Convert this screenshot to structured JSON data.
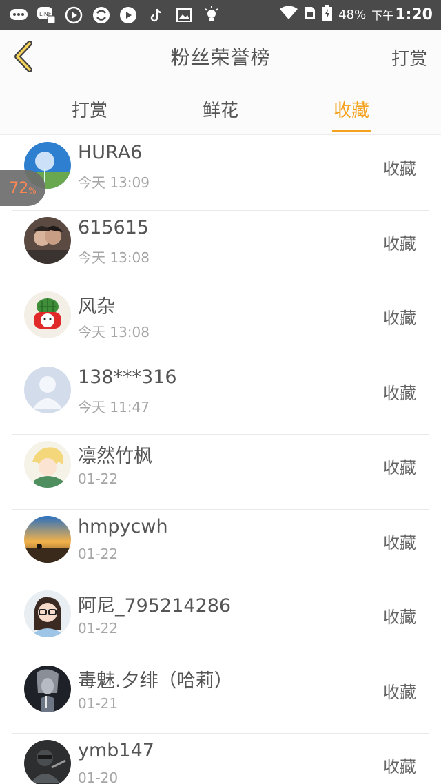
{
  "status_bar": {
    "time_prefix": "下午",
    "time": "1:20",
    "battery": "48%",
    "left_icons": [
      "chat-icon",
      "line-icon",
      "play-icon",
      "sync-icon",
      "video-icon",
      "tiktok-icon",
      "image-icon",
      "bulb-icon"
    ]
  },
  "header": {
    "title": "粉丝荣誉榜",
    "action": "打赏"
  },
  "tabs": [
    {
      "label": "打赏",
      "active": false
    },
    {
      "label": "鲜花",
      "active": false
    },
    {
      "label": "收藏",
      "active": true
    }
  ],
  "badge": {
    "value": "72",
    "unit": "%"
  },
  "rows": [
    {
      "name": "HURA6",
      "time": "今天 13:09",
      "action": "收藏",
      "avatar": "dandelion"
    },
    {
      "name": "615615",
      "time": "今天 13:08",
      "action": "收藏",
      "avatar": "couple"
    },
    {
      "name": "风杂",
      "time": "今天 13:08",
      "action": "收藏",
      "avatar": "cactus"
    },
    {
      "name": "138***316",
      "time": "今天 11:47",
      "action": "收藏",
      "avatar": "default"
    },
    {
      "name": "凛然竹枫",
      "time": "01-22",
      "action": "收藏",
      "avatar": "anime"
    },
    {
      "name": "hmpycwh",
      "time": "01-22",
      "action": "收藏",
      "avatar": "sunset"
    },
    {
      "name": "阿尼_795214286",
      "time": "01-22",
      "action": "收藏",
      "avatar": "girl"
    },
    {
      "name": "毒魅.夕绯（哈莉）",
      "time": "01-21",
      "action": "收藏",
      "avatar": "dark"
    },
    {
      "name": "ymb147",
      "time": "01-20",
      "action": "收藏",
      "avatar": "soldier"
    }
  ],
  "colors": {
    "accent": "#f4a11d",
    "status_bar_bg": "#4a4a4a",
    "badge_text": "#ff7d45"
  }
}
